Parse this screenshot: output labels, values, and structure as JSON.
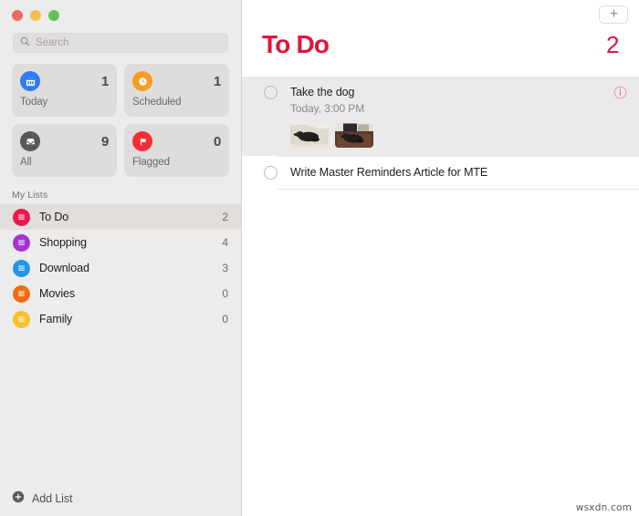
{
  "window": {
    "traffic_lights": [
      {
        "name": "close",
        "color": "#ec6a5f"
      },
      {
        "name": "minimize",
        "color": "#f5bd4f"
      },
      {
        "name": "maximize",
        "color": "#61c454"
      }
    ]
  },
  "sidebar": {
    "search": {
      "placeholder": "Search",
      "value": "",
      "icon": "search-icon"
    },
    "smart_lists": [
      {
        "label": "Today",
        "count": "1",
        "icon": "calendar-icon",
        "color": "#2f7cf6"
      },
      {
        "label": "Scheduled",
        "count": "1",
        "icon": "clock-icon",
        "color": "#f59c21"
      },
      {
        "label": "All",
        "count": "9",
        "icon": "inbox-icon",
        "color": "#57585a"
      },
      {
        "label": "Flagged",
        "count": "0",
        "icon": "flag-icon",
        "color": "#f42e34"
      }
    ],
    "section_header": "My Lists",
    "lists": [
      {
        "label": "To Do",
        "count": "2",
        "color": "#e8194b",
        "selected": true
      },
      {
        "label": "Shopping",
        "count": "4",
        "color": "#a932cf",
        "selected": false
      },
      {
        "label": "Download",
        "count": "3",
        "color": "#2196e8",
        "selected": false
      },
      {
        "label": "Movies",
        "count": "0",
        "color": "#ef6c11",
        "selected": false
      },
      {
        "label": "Family",
        "count": "0",
        "color": "#fbc02d",
        "selected": false
      }
    ],
    "add_list": {
      "label": "Add List",
      "icon": "plus-circle-icon"
    }
  },
  "content": {
    "add_button_icon": "plus-icon",
    "title": "To Do",
    "title_color": "#e0143c",
    "count": "2",
    "reminders": [
      {
        "title": "Take the dog",
        "subtitle": "Today, 3:00 PM",
        "highlighted": true,
        "has_info": true,
        "info_icon": "info-circle-icon",
        "attachments": [
          {
            "name": "photo-dog-on-blanket"
          },
          {
            "name": "photo-dog-on-couch"
          }
        ]
      },
      {
        "title": "Write Master Reminders Article for MTE",
        "subtitle": "",
        "highlighted": false,
        "has_info": false,
        "attachments": []
      }
    ]
  },
  "watermark": "wsxdn.com"
}
